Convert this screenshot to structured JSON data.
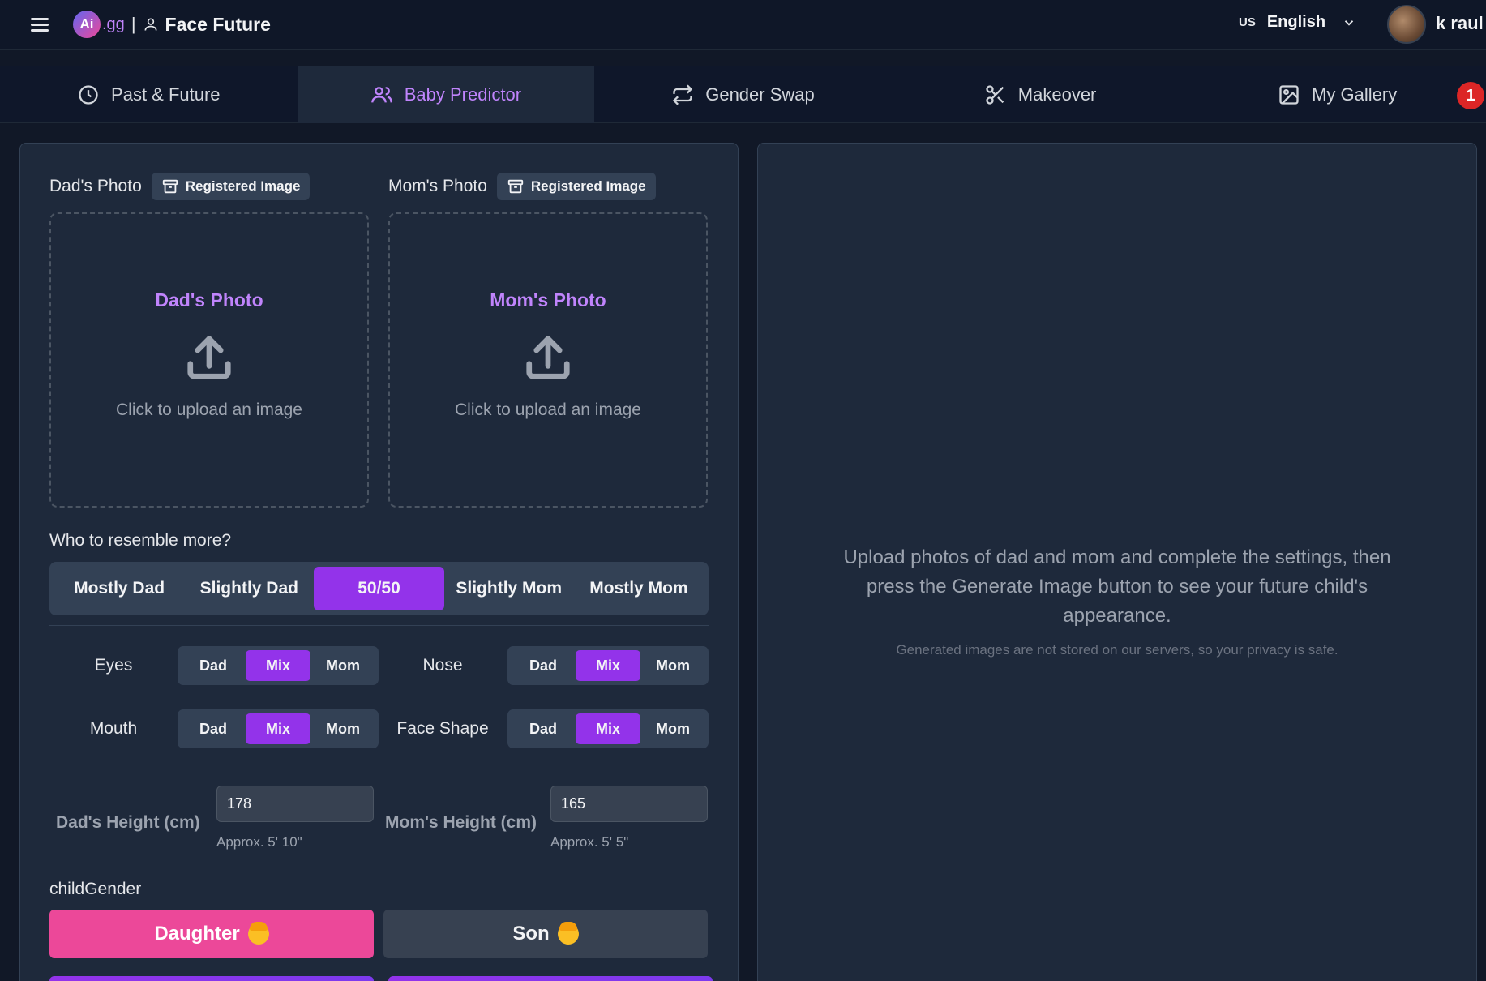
{
  "header": {
    "logo_text": "Ai",
    "logo_suffix": ".gg",
    "separator": "|",
    "app_title": "Face Future",
    "lang_code": "US",
    "lang_name": "English",
    "username": "k raul"
  },
  "tabs": [
    {
      "label": "Past & Future",
      "icon": "clock-icon"
    },
    {
      "label": "Baby Predictor",
      "icon": "users-icon",
      "active": true
    },
    {
      "label": "Gender Swap",
      "icon": "repeat-icon"
    },
    {
      "label": "Makeover",
      "icon": "scissors-icon"
    },
    {
      "label": "My Gallery",
      "icon": "image-icon"
    }
  ],
  "notification_count": "1",
  "upload": {
    "dad_label": "Dad's Photo",
    "mom_label": "Mom's Photo",
    "registered_label": "Registered Image",
    "dad_drop_title": "Dad's Photo",
    "mom_drop_title": "Mom's Photo",
    "drop_hint": "Click to upload an image"
  },
  "resemble": {
    "label": "Who to resemble more?",
    "options": [
      "Mostly Dad",
      "Slightly Dad",
      "50/50",
      "Slightly Mom",
      "Mostly Mom"
    ],
    "selected": "50/50"
  },
  "features": {
    "options": [
      "Dad",
      "Mix",
      "Mom"
    ],
    "eyes_label": "Eyes",
    "nose_label": "Nose",
    "mouth_label": "Mouth",
    "face_shape_label": "Face Shape",
    "selected": "Mix"
  },
  "heights": {
    "dad_label": "Dad's Height (cm)",
    "dad_value": "178",
    "dad_hint": "Approx. 5' 10\"",
    "mom_label": "Mom's Height (cm)",
    "mom_value": "165",
    "mom_hint": "Approx. 5' 5\""
  },
  "gender": {
    "label": "childGender",
    "daughter": "Daughter",
    "son": "Son",
    "selected": "Daughter"
  },
  "info": {
    "main": "Upload photos of dad and mom and complete the settings, then press the Generate Image button to see your future child's appearance.",
    "sub": "Generated images are not stored on our servers, so your privacy is safe."
  },
  "colors": {
    "accent": "#9333ea",
    "accent_text": "#c084fc",
    "daughter": "#ec4899",
    "badge": "#dc2626"
  }
}
